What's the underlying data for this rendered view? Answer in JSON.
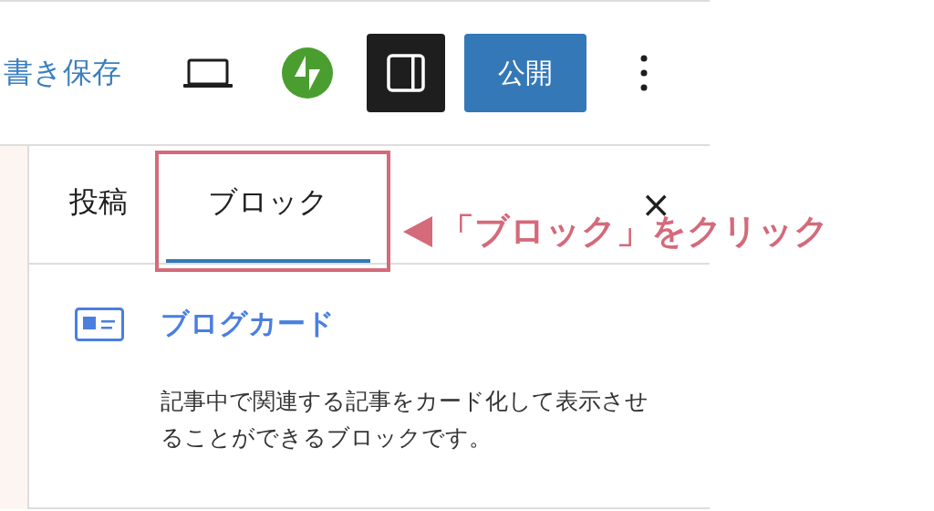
{
  "toolbar": {
    "save_draft": "書き保存",
    "settings_toggle": {
      "on": true
    },
    "publish_button": "公開"
  },
  "sidebar": {
    "tabs": [
      {
        "label": "投稿",
        "selected": false
      },
      {
        "label": "ブロック",
        "selected": true
      }
    ],
    "close_button": "×",
    "block": {
      "title": "ブログカード",
      "description": "記事中で関連する記事をカード化して表示させることができるブロックです。"
    }
  },
  "annotation": {
    "text": "「ブロック」をクリック"
  }
}
